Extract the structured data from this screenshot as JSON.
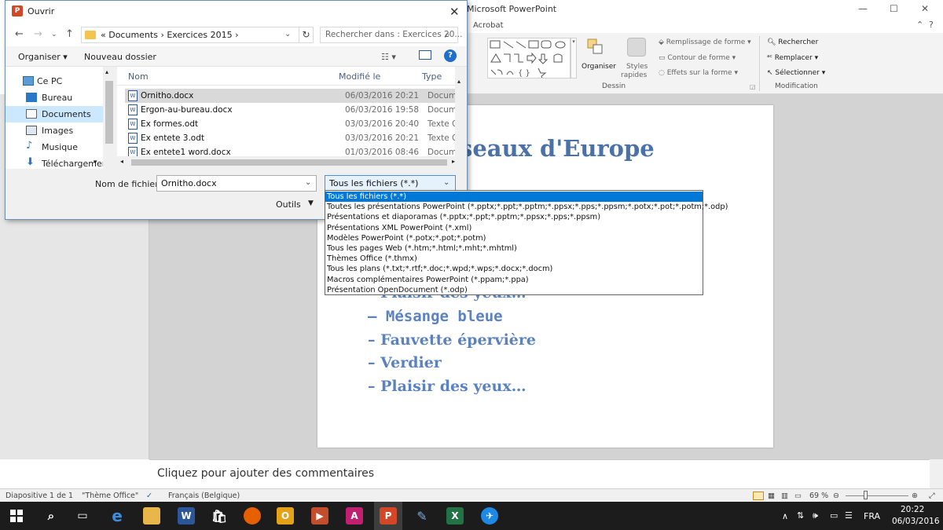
{
  "ppt": {
    "title": "Microsoft PowerPoint",
    "window_controls": [
      "—",
      "☐",
      "✕"
    ],
    "tab_acrobat": "Acrobat",
    "ribbon": {
      "organiser": "Organiser",
      "styles_line1": "Styles",
      "styles_line2": "rapides",
      "remplissage": "Remplissage de forme",
      "contour": "Contour de forme",
      "effets": "Effets sur la forme",
      "rechercher": "Rechercher",
      "remplacer": "Remplacer",
      "selectionner": "Sélectionner",
      "group_dessin": "Dessin",
      "group_modification": "Modification"
    },
    "slide": {
      "title_visible": "iseaux d'Europe",
      "bullets": [
        {
          "text": "– Plaisir des yeux…",
          "style": "serif"
        },
        {
          "text": "– Mésange bleue",
          "style": "mono"
        },
        {
          "text": "– Fauvette épervière",
          "style": "serif"
        },
        {
          "text": "– Verdier",
          "style": "serif"
        },
        {
          "text": "– Plaisir des yeux…",
          "style": "serif"
        }
      ]
    },
    "notes_placeholder": "Cliquez pour ajouter des commentaires",
    "status": {
      "slide_info": "Diapositive 1 de 1",
      "theme": "\"Thème Office\"",
      "language": "Français (Belgique)",
      "zoom": "69 %"
    }
  },
  "dialog": {
    "title": "Ouvrir",
    "breadcrumb": "«  Documents  ›  Exercices 2015  ›",
    "search_placeholder": "Rechercher dans : Exercices 20...",
    "organiser": "Organiser ▾",
    "nouveau_dossier": "Nouveau dossier",
    "nav_items": [
      {
        "label": "Ce PC",
        "icon": "computer-icon",
        "selected": false
      },
      {
        "label": "Bureau",
        "icon": "desktop-folder-icon",
        "selected": false
      },
      {
        "label": "Documents",
        "icon": "documents-folder-icon",
        "selected": true
      },
      {
        "label": "Images",
        "icon": "images-folder-icon",
        "selected": false
      },
      {
        "label": "Musique",
        "icon": "music-folder-icon",
        "selected": false
      },
      {
        "label": "Téléchargement",
        "icon": "download-folder-icon",
        "selected": false
      }
    ],
    "columns": {
      "name": "Nom",
      "modified": "Modifié le",
      "type": "Type"
    },
    "files": [
      {
        "name": "Ornitho.docx",
        "date": "06/03/2016 20:21",
        "type": "Document",
        "selected": true
      },
      {
        "name": "Ergon-au-bureau.docx",
        "date": "06/03/2016 19:58",
        "type": "Document",
        "selected": false
      },
      {
        "name": "Ex formes.odt",
        "date": "03/03/2016 20:40",
        "type": "Texte Op",
        "selected": false
      },
      {
        "name": "Ex entete 3.odt",
        "date": "03/03/2016 20:21",
        "type": "Texte Op",
        "selected": false
      },
      {
        "name": "Ex entete1 word.docx",
        "date": "01/03/2016 08:46",
        "type": "Document",
        "selected": false
      }
    ],
    "filename_label": "Nom de fichier :",
    "filename_value": "Ornitho.docx",
    "filter_value": "Tous les fichiers (*.*)",
    "outils": "Outils",
    "filter_options": [
      "Tous les fichiers (*.*)",
      "Toutes les présentations PowerPoint (*.pptx;*.ppt;*.pptm;*.ppsx;*.pps;*.ppsm;*.potx;*.pot;*.potm;*.odp)",
      "Présentations et diaporamas (*.pptx;*.ppt;*.pptm;*.ppsx;*.pps;*.ppsm)",
      "Présentations XML PowerPoint (*.xml)",
      "Modèles PowerPoint (*.potx;*.pot;*.potm)",
      "Tous les pages Web (*.htm;*.html;*.mht;*.mhtml)",
      "Thèmes Office (*.thmx)",
      "Tous les plans (*.txt;*.rtf;*.doc;*.wpd;*.wps;*.docx;*.docm)",
      "Macros complémentaires PowerPoint (*.ppam;*.ppa)",
      "Présentation OpenDocument  (*.odp)"
    ]
  },
  "taskbar": {
    "language": "FRA",
    "time": "20:22",
    "date": "06/03/2016"
  }
}
